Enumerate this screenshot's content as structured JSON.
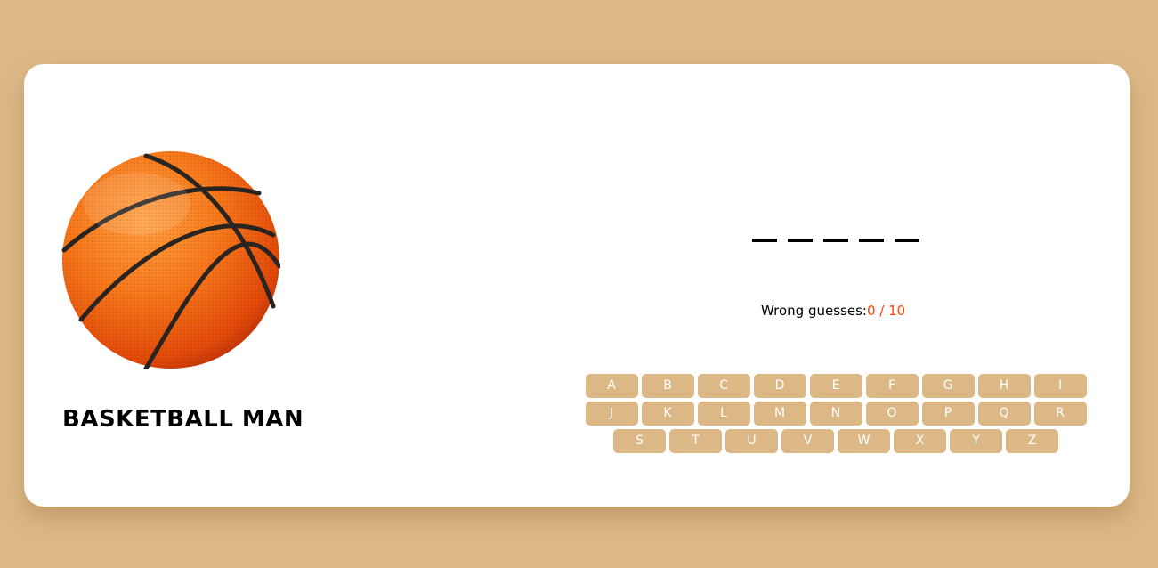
{
  "game": {
    "title": "BASKETBALL MAN",
    "word_length": 5,
    "wrong_label": "Wrong guesses:",
    "wrong_count": "0 / 10"
  },
  "keyboard": {
    "letters": [
      "A",
      "B",
      "C",
      "D",
      "E",
      "F",
      "G",
      "H",
      "I",
      "J",
      "K",
      "L",
      "M",
      "N",
      "O",
      "P",
      "Q",
      "R",
      "S",
      "T",
      "U",
      "V",
      "W",
      "X",
      "Y",
      "Z"
    ]
  },
  "colors": {
    "background": "#DDB887",
    "card": "#FFFFFF",
    "key": "#DDB887",
    "accent": "#FF4500"
  },
  "icons": {
    "hero": "basketball-icon"
  }
}
